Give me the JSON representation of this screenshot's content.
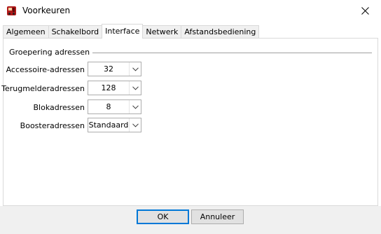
{
  "window": {
    "title": "Voorkeuren",
    "icons": {
      "app": "locomotive-app-icon",
      "close": "close-icon"
    }
  },
  "tabs": [
    {
      "label": "Algemeen",
      "active": false
    },
    {
      "label": "Schakelbord",
      "active": false
    },
    {
      "label": "Interface",
      "active": true
    },
    {
      "label": "Netwerk",
      "active": false
    },
    {
      "label": "Afstandsbediening",
      "active": false
    }
  ],
  "group": {
    "title": "Groepering adressen",
    "rows": [
      {
        "label": "Accessoire-adressen",
        "value": "32"
      },
      {
        "label": "Terugmelderadressen",
        "value": "128"
      },
      {
        "label": "Blokadressen",
        "value": "8"
      },
      {
        "label": "Boosteradressen",
        "value": "Standaard"
      }
    ]
  },
  "buttons": {
    "ok": "OK",
    "cancel": "Annuleer"
  },
  "colors": {
    "focus": "#0078d7",
    "bottom_bar": "#f0f0f0"
  }
}
